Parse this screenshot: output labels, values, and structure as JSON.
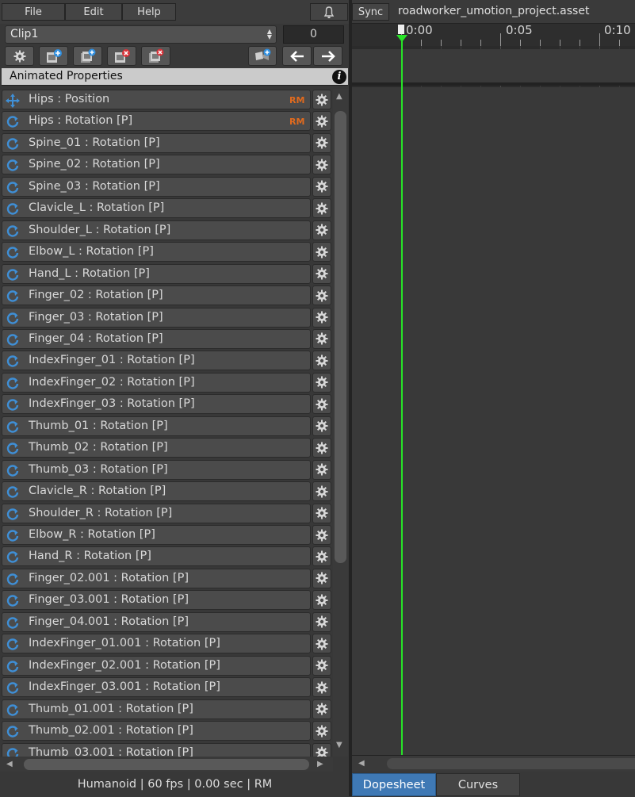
{
  "menu": {
    "items": [
      "File",
      "Edit",
      "Help"
    ]
  },
  "clip": {
    "name": "Clip1",
    "frame": "0"
  },
  "toolbar": {
    "icons": [
      "gear-icon",
      "add-clip-icon",
      "duplicate-clip-icon",
      "delete-clip-icon",
      "delete-keys-icon",
      "camera-add-icon",
      "previous-arrow-icon",
      "next-arrow-icon"
    ]
  },
  "header": {
    "title": "Animated Properties",
    "info_icon": "info-icon"
  },
  "properties": [
    {
      "label": "Hips : Position",
      "type": "position",
      "rm": "RM"
    },
    {
      "label": "Hips : Rotation [P]",
      "type": "rotation",
      "rm": "RM"
    },
    {
      "label": "Spine_01 : Rotation [P]",
      "type": "rotation"
    },
    {
      "label": "Spine_02 : Rotation [P]",
      "type": "rotation"
    },
    {
      "label": "Spine_03 : Rotation [P]",
      "type": "rotation"
    },
    {
      "label": "Clavicle_L : Rotation [P]",
      "type": "rotation"
    },
    {
      "label": "Shoulder_L : Rotation [P]",
      "type": "rotation"
    },
    {
      "label": "Elbow_L : Rotation [P]",
      "type": "rotation"
    },
    {
      "label": "Hand_L : Rotation [P]",
      "type": "rotation"
    },
    {
      "label": "Finger_02 : Rotation [P]",
      "type": "rotation"
    },
    {
      "label": "Finger_03 : Rotation [P]",
      "type": "rotation"
    },
    {
      "label": "Finger_04 : Rotation [P]",
      "type": "rotation"
    },
    {
      "label": "IndexFinger_01 : Rotation [P]",
      "type": "rotation"
    },
    {
      "label": "IndexFinger_02 : Rotation [P]",
      "type": "rotation"
    },
    {
      "label": "IndexFinger_03 : Rotation [P]",
      "type": "rotation"
    },
    {
      "label": "Thumb_01 : Rotation [P]",
      "type": "rotation"
    },
    {
      "label": "Thumb_02 : Rotation [P]",
      "type": "rotation"
    },
    {
      "label": "Thumb_03 : Rotation [P]",
      "type": "rotation"
    },
    {
      "label": "Clavicle_R : Rotation [P]",
      "type": "rotation"
    },
    {
      "label": "Shoulder_R : Rotation [P]",
      "type": "rotation"
    },
    {
      "label": "Elbow_R : Rotation [P]",
      "type": "rotation"
    },
    {
      "label": "Hand_R : Rotation [P]",
      "type": "rotation"
    },
    {
      "label": "Finger_02.001 : Rotation [P]",
      "type": "rotation"
    },
    {
      "label": "Finger_03.001 : Rotation [P]",
      "type": "rotation"
    },
    {
      "label": "Finger_04.001 : Rotation [P]",
      "type": "rotation"
    },
    {
      "label": "IndexFinger_01.001 : Rotation [P]",
      "type": "rotation"
    },
    {
      "label": "IndexFinger_02.001 : Rotation [P]",
      "type": "rotation"
    },
    {
      "label": "IndexFinger_03.001 : Rotation [P]",
      "type": "rotation"
    },
    {
      "label": "Thumb_01.001 : Rotation [P]",
      "type": "rotation"
    },
    {
      "label": "Thumb_02.001 : Rotation [P]",
      "type": "rotation"
    },
    {
      "label": "Thumb_03.001 : Rotation [P]",
      "type": "rotation"
    }
  ],
  "status": {
    "text": "Humanoid | 60 fps | 0.00 sec | RM"
  },
  "timeline": {
    "sync_label": "Sync",
    "asset_name": "roadworker_umotion_project.asset",
    "ticks": [
      "0:00",
      "0:05",
      "0:10"
    ],
    "playhead_frame": 0,
    "playhead_color": "#27e327"
  },
  "tabs": {
    "dopesheet": "Dopesheet",
    "curves": "Curves",
    "active": "Dopesheet"
  },
  "colors": {
    "accent": "#3f79b5",
    "rm": "#e06a1e",
    "rotate_icon": "#3f8fd6"
  }
}
